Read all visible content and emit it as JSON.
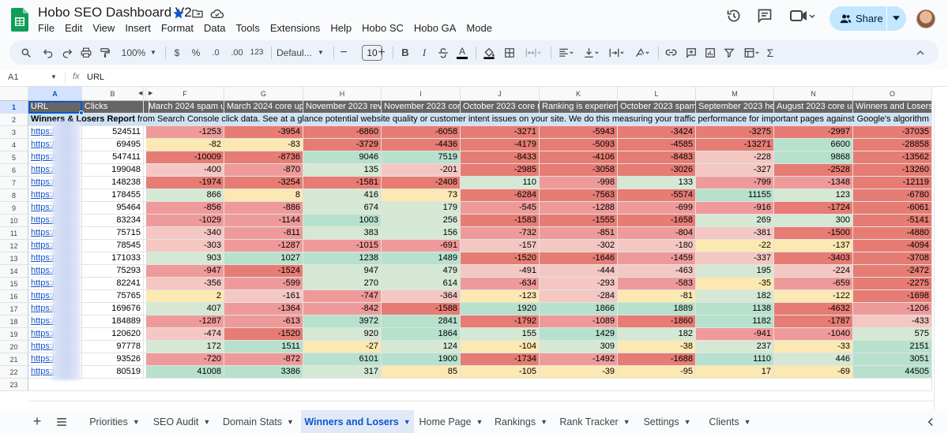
{
  "app": {
    "title": "Hobo SEO Dashboard V2",
    "menu": [
      "File",
      "Edit",
      "View",
      "Insert",
      "Format",
      "Data",
      "Tools",
      "Extensions",
      "Help",
      "Hobo SC",
      "Hobo GA",
      "Mode"
    ],
    "share_label": "Share"
  },
  "toolbar": {
    "zoom": "100%",
    "currency": "$",
    "percent": "%",
    "dec_less": ".0",
    "dec_more": ".00",
    "number_format": "123",
    "font": "Defaul...",
    "font_size": "10",
    "bold": "B",
    "italic": "I",
    "text_color": "A",
    "functions": "Σ"
  },
  "formula_bar": {
    "cell_ref": "A1",
    "fx": "fx",
    "value": "URL"
  },
  "columns": [
    "A",
    "B",
    "",
    "F",
    "G",
    "H",
    "I",
    "J",
    "K",
    "L",
    "M",
    "N",
    "O"
  ],
  "rows": [
    "1",
    "2",
    "3",
    "4",
    "5",
    "6",
    "7",
    "8",
    "9",
    "10",
    "11",
    "12",
    "13",
    "14",
    "15",
    "16",
    "17",
    "18",
    "19",
    "20",
    "21",
    "22",
    "23"
  ],
  "sheet": {
    "headers": [
      "URL",
      "Clicks",
      "March 2024 spam up",
      "March 2024 core upd",
      "November 2023 revie",
      "November 2023 core",
      "October 2023 core u",
      "Ranking is experienc",
      "October 2023 spam u",
      "September 2023 help",
      "August 2023 core up",
      "Winners and Losers"
    ],
    "banner_bold": "Winners & Losers Report",
    "banner_rest": " from Search Console click data. See at a glance potential website quality or customer intent issues on your site. We do this measuring your traffic performance for important pages against Google's algorithm updates.",
    "url_text": "https://",
    "data": [
      [
        524511,
        -1253,
        -3954,
        -6860,
        -6058,
        -3271,
        -5943,
        -3424,
        -3275,
        -2997,
        -37035
      ],
      [
        69495,
        -82,
        -83,
        -3729,
        -4436,
        -4179,
        -5093,
        -4585,
        -13271,
        6600,
        -28858
      ],
      [
        547411,
        -10009,
        -8736,
        9046,
        7519,
        -8433,
        -4106,
        -8483,
        -228,
        9868,
        -13562
      ],
      [
        199048,
        -400,
        -870,
        135,
        -201,
        -2985,
        -3058,
        -3026,
        -327,
        -2528,
        -13260
      ],
      [
        148238,
        -1974,
        -3254,
        -1581,
        -2408,
        110,
        -998,
        133,
        -799,
        -1348,
        -12119
      ],
      [
        178455,
        866,
        8,
        416,
        73,
        -6284,
        -7563,
        -5574,
        11155,
        123,
        -6780
      ],
      [
        95464,
        -856,
        -886,
        674,
        179,
        -545,
        -1288,
        -699,
        -916,
        -1724,
        -6061
      ],
      [
        83234,
        -1029,
        -1144,
        1003,
        256,
        -1583,
        -1555,
        -1658,
        269,
        300,
        -5141
      ],
      [
        75715,
        -340,
        -811,
        383,
        156,
        -732,
        -851,
        -804,
        -381,
        -1500,
        -4880
      ],
      [
        78545,
        -303,
        -1287,
        -1015,
        -691,
        -157,
        -302,
        -180,
        -22,
        -137,
        -4094
      ],
      [
        171033,
        903,
        1027,
        1238,
        1489,
        -1520,
        -1646,
        -1459,
        -337,
        -3403,
        -3708
      ],
      [
        75293,
        -947,
        -1524,
        947,
        479,
        -491,
        -444,
        -463,
        195,
        -224,
        -2472
      ],
      [
        82241,
        -356,
        -599,
        270,
        614,
        -634,
        -293,
        -583,
        -35,
        -659,
        -2275
      ],
      [
        75765,
        2,
        -161,
        -747,
        -364,
        -123,
        -284,
        -81,
        182,
        -122,
        -1698
      ],
      [
        169676,
        407,
        -1364,
        -842,
        -1588,
        1920,
        1866,
        1889,
        1138,
        -4632,
        -1206
      ],
      [
        184889,
        -1287,
        -613,
        3972,
        2841,
        -1792,
        -1089,
        -1860,
        1182,
        -1787,
        -433
      ],
      [
        120620,
        -474,
        -1520,
        920,
        1864,
        155,
        1429,
        182,
        -941,
        -1040,
        575
      ],
      [
        97778,
        172,
        1511,
        -27,
        124,
        -104,
        309,
        -38,
        237,
        -33,
        2151
      ],
      [
        93526,
        -720,
        -872,
        6101,
        1900,
        -1734,
        -1492,
        -1688,
        1110,
        446,
        3051
      ],
      [
        80519,
        41008,
        3386,
        317,
        85,
        -105,
        -39,
        -95,
        17,
        -69,
        44505
      ]
    ]
  },
  "colors": {
    "strong_neg": "#e67c73",
    "mid_neg": "#ef9a9a",
    "light_neg": "#f4c7c3",
    "near_zero": "#fce8b2",
    "light_pos": "#d5e8d4",
    "mid_pos": "#b7e1cd",
    "header_bg": "#666666",
    "banner_bg": "#cfe2f3"
  },
  "sheets": [
    "Priorities",
    "SEO Audit",
    "Domain Stats",
    "Winners and Losers",
    "Home Page",
    "Rankings",
    "Rank Tracker",
    "Settings",
    "Clients"
  ],
  "active_sheet": "Winners and Losers"
}
